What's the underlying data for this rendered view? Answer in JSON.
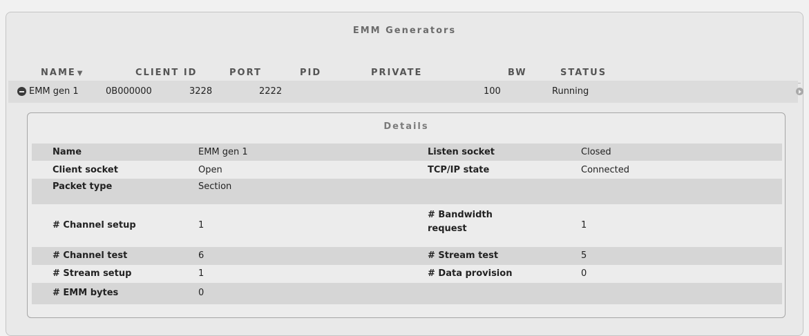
{
  "panel_title": "EMM Generators",
  "columns": {
    "name": "NAME",
    "client_id": "CLIENT ID",
    "port": "PORT",
    "pid": "PID",
    "private": "PRIVATE",
    "bw": "BW",
    "status": "STATUS"
  },
  "generators": [
    {
      "name": "EMM gen 1",
      "client_id": "0B000000",
      "port": "3228",
      "pid": "2222",
      "private": "",
      "bw": "100",
      "status": "Running"
    }
  ],
  "details": {
    "title": "Details",
    "rows": [
      {
        "left_label": "Name",
        "left_value": "EMM gen 1",
        "right_label": "Listen socket",
        "right_value": "Closed"
      },
      {
        "left_label": "Client socket",
        "left_value": "Open",
        "right_label": "TCP/IP state",
        "right_value": "Connected"
      },
      {
        "left_label": "Packet type",
        "left_value": "Section",
        "right_label": "",
        "right_value": ""
      },
      {
        "left_label": "# Channel setup",
        "left_value": "1",
        "right_label": "# Bandwidth request",
        "right_value": "1"
      },
      {
        "left_label": "# Channel test",
        "left_value": "6",
        "right_label": "# Stream test",
        "right_value": "5"
      },
      {
        "left_label": "# Stream setup",
        "left_value": "1",
        "right_label": "# Data provision",
        "right_value": "0"
      },
      {
        "left_label": "# EMM bytes",
        "left_value": "0",
        "right_label": "",
        "right_value": ""
      }
    ]
  }
}
